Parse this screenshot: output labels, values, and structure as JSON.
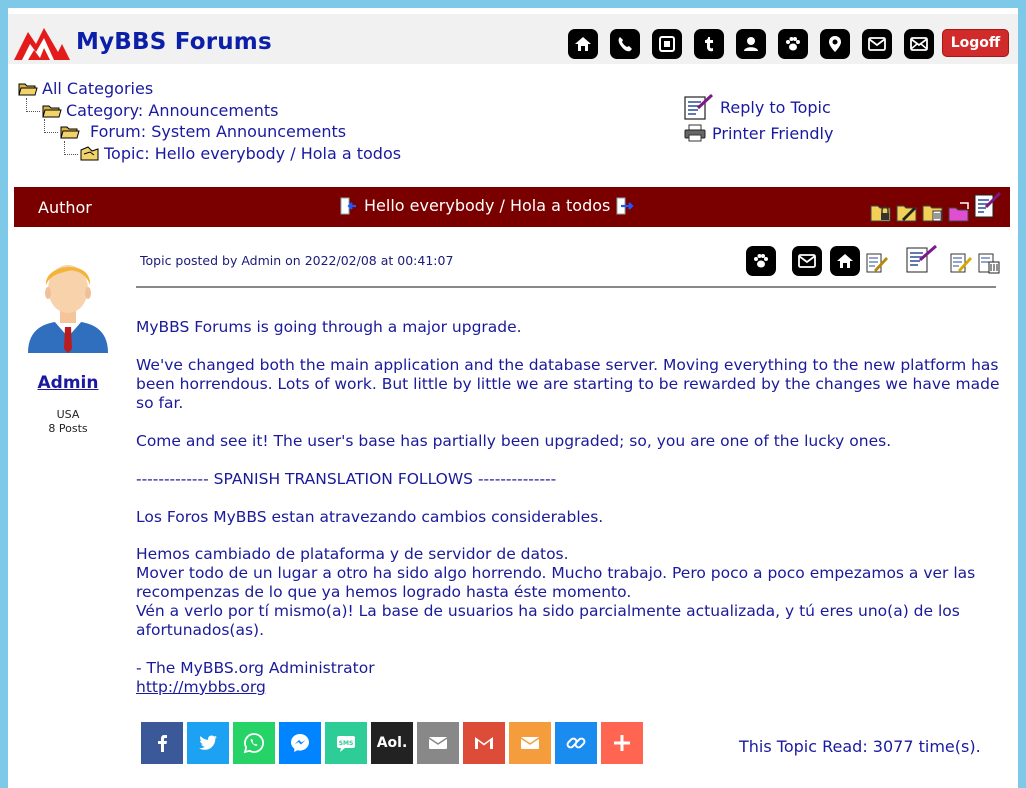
{
  "header": {
    "site_title": "MyBBS Forums",
    "logoff_label": "Logoff",
    "nav_icons": [
      "home-icon",
      "phone-icon",
      "stop-icon",
      "tumblr-icon",
      "user-icon",
      "paw-icon",
      "location-pin-icon",
      "envelope-icon",
      "envelope-icon"
    ]
  },
  "breadcrumb": {
    "all_categories": "All Categories",
    "category": "Category: Announcements",
    "forum": "Forum: System Announcements",
    "topic": "Topic: Hello everybody / Hola a todos"
  },
  "topic_actions": {
    "reply": "Reply to Topic",
    "printer": "Printer Friendly"
  },
  "topic_bar": {
    "author_label": "Author",
    "title": "Hello everybody / Hola a todos"
  },
  "author": {
    "name": "Admin",
    "country": "USA",
    "posts": "8 Posts"
  },
  "post": {
    "posted_prefix": "Topic posted by",
    "posted_user": "Admin",
    "posted_on": "on 2022/02/08 at 00:41:07",
    "paragraphs": [
      "MyBBS Forums is going through a major upgrade.",
      "We've changed both the main application and the database server. Moving everything to the new platform has been horrendous. Lots of work. But little by little we are starting to be rewarded by the changes we have made so far.",
      "Come and see it! The user's base has partially been upgraded; so, you are one of the lucky ones.",
      "------------- SPANISH TRANSLATION FOLLOWS --------------",
      "Los Foros MyBBS estan atravezando cambios considerables.",
      "Hemos cambiado de plataforma y de servidor de datos.\nMover todo de un lugar a otro ha sido algo horrendo. Mucho trabajo. Pero poco a poco empezamos a ver las recompenzas de lo que ya hemos logrado hasta éste momento.\nVén a verlo por tí mismo(a)! La base de usuarios ha sido parcialmente actualizada, y tú eres uno(a) de los afortunados(as).",
      "- The MyBBS.org Administrator"
    ],
    "link": "http://mybbs.org"
  },
  "share": {
    "aol_label": "Aol.",
    "buttons": [
      {
        "icon": "facebook-icon",
        "color": "#3b5998"
      },
      {
        "icon": "twitter-icon",
        "color": "#1da1f2"
      },
      {
        "icon": "whatsapp-icon",
        "color": "#25d366"
      },
      {
        "icon": "messenger-icon",
        "color": "#0084ff"
      },
      {
        "icon": "sms-icon",
        "color": "#2ecc97"
      },
      {
        "icon": "aol-icon",
        "color": "#222222"
      },
      {
        "icon": "email-icon",
        "color": "#888888"
      },
      {
        "icon": "gmail-icon",
        "color": "#dd4b39"
      },
      {
        "icon": "mail-icon",
        "color": "#f59d3d"
      },
      {
        "icon": "copy-link-icon",
        "color": "#1a8cf0"
      },
      {
        "icon": "more-icon",
        "color": "#ff6550"
      }
    ]
  },
  "footer": {
    "read_count": "This Topic Read: 3077 time(s)."
  },
  "colors": {
    "page_border": "#7ec8e8",
    "topic_bar": "#7a0000",
    "link": "#1a1aa0",
    "logoff": "#d02a2a"
  }
}
